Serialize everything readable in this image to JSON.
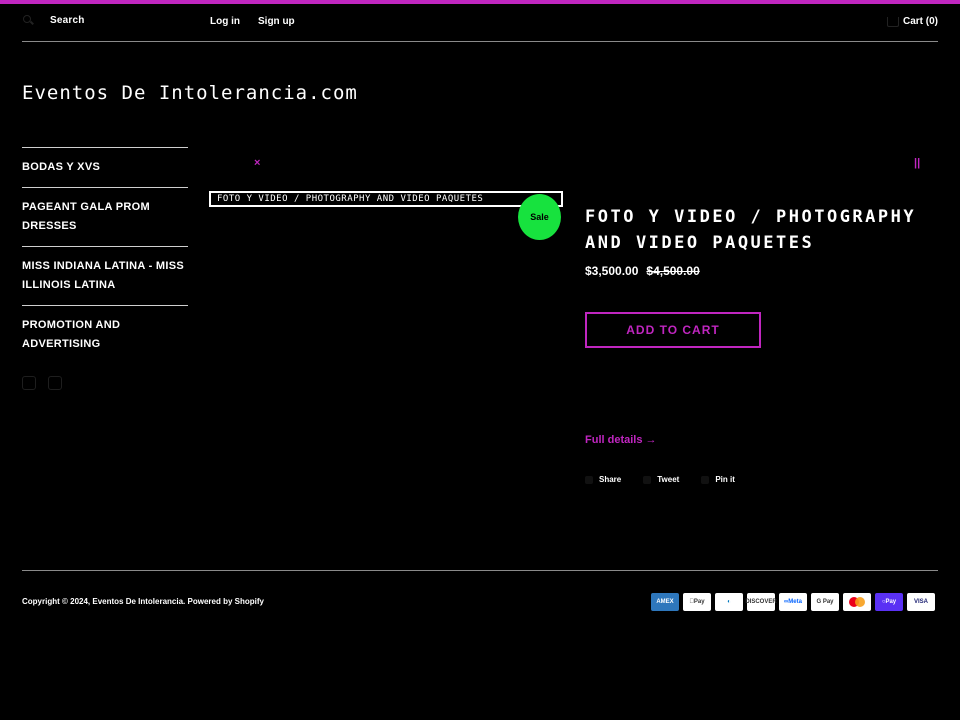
{
  "header": {
    "search_label": "Search",
    "login_label": "Log in",
    "signup_label": "Sign up",
    "cart_label": "Cart (0)"
  },
  "site_title": "Eventos De Intolerancia.com",
  "sidebar": {
    "items": [
      {
        "label": "BODAS Y XVS"
      },
      {
        "label": "PAGEANT GALA PROM DRESSES"
      },
      {
        "label": "MISS INDIANA LATINA - MISS ILLINOIS LATINA"
      },
      {
        "label": "PROMOTION AND ADVERTISING"
      }
    ],
    "social": [
      "facebook-icon",
      "instagram-icon"
    ]
  },
  "gallery": {
    "prev_marker": "×",
    "next_marker": "||"
  },
  "product": {
    "image_alt": "FOTO Y VIDEO / PHOTOGRAPHY AND VIDEO PAQUETES",
    "sale_badge": "Sale",
    "title": "FOTO Y VIDEO / PHOTOGRAPHY AND VIDEO PAQUETES",
    "price_current": "$3,500.00",
    "price_compare": "$4,500.00",
    "add_to_cart": "ADD TO CART",
    "full_details": "Full details →"
  },
  "share": {
    "share_label": "Share",
    "tweet_label": "Tweet",
    "pin_label": "Pin it"
  },
  "footer": {
    "copyright": "Copyright © 2024, Eventos De Intolerancia. Powered by Shopify",
    "payments": [
      "American Express",
      "Apple Pay",
      "Diners Club",
      "Discover",
      "Meta Pay",
      "Google Pay",
      "Mastercard",
      "Shop Pay",
      "Visa"
    ]
  },
  "colors": {
    "accent": "#c026c0",
    "sale": "#17e23e",
    "background": "#000000"
  }
}
